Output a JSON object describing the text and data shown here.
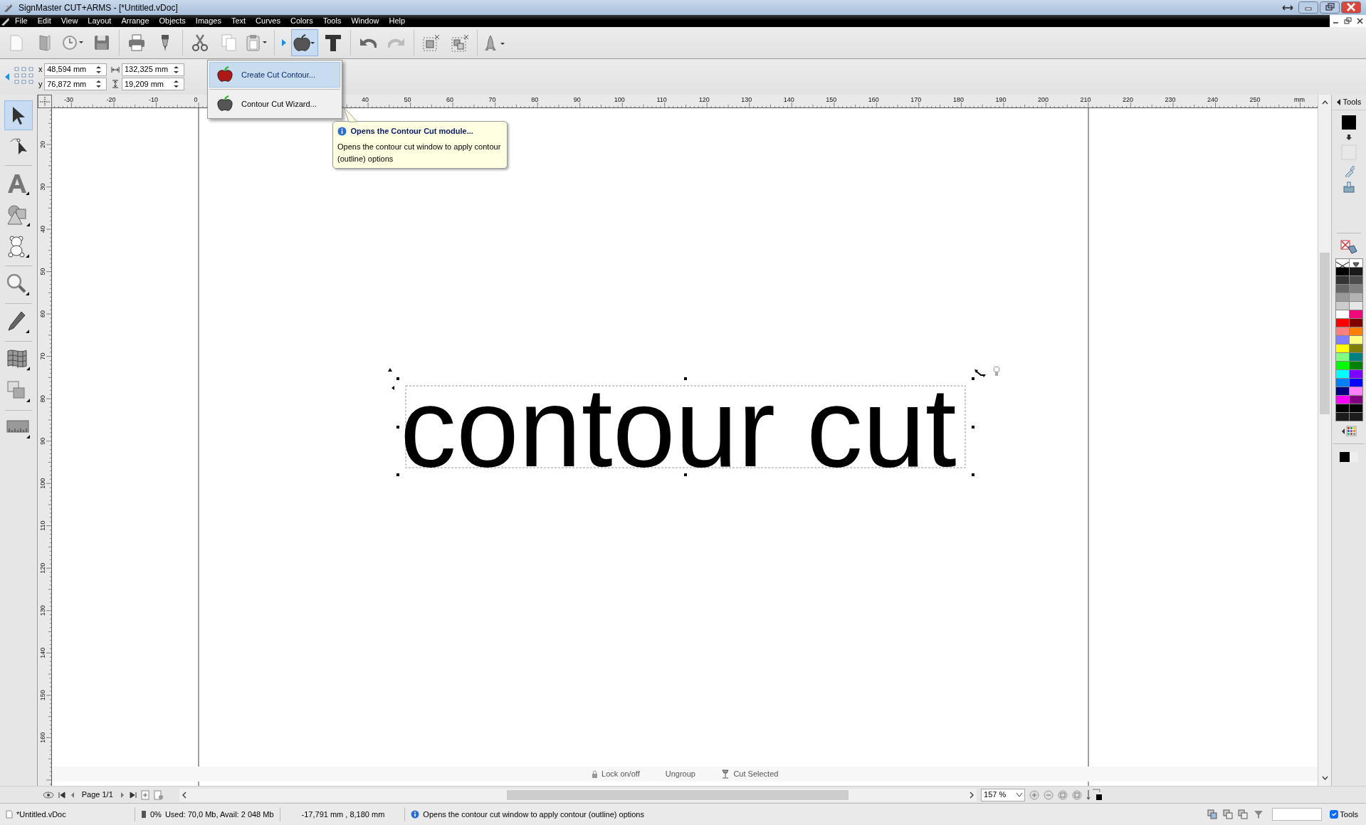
{
  "window": {
    "title": "SignMaster CUT+ARMS - [*Untitled.vDoc]"
  },
  "menu": [
    "File",
    "Edit",
    "View",
    "Layout",
    "Arrange",
    "Objects",
    "Images",
    "Text",
    "Curves",
    "Colors",
    "Tools",
    "Window",
    "Help"
  ],
  "toolbar": [
    {
      "kind": "new",
      "active": false
    },
    {
      "kind": "open",
      "active": false
    },
    {
      "kind": "history",
      "active": false
    },
    {
      "kind": "save",
      "active": false
    },
    {
      "kind": "sep"
    },
    {
      "kind": "print",
      "active": false
    },
    {
      "kind": "cutter",
      "active": false
    },
    {
      "kind": "sep"
    },
    {
      "kind": "cut",
      "active": false
    },
    {
      "kind": "copy",
      "active": false
    },
    {
      "kind": "paste",
      "active": false
    },
    {
      "kind": "sep"
    },
    {
      "kind": "expander",
      "active": false
    },
    {
      "kind": "contour",
      "active": true
    },
    {
      "kind": "text",
      "active": false
    },
    {
      "kind": "sep"
    },
    {
      "kind": "undo",
      "active": false
    },
    {
      "kind": "redo",
      "active": false
    },
    {
      "kind": "sep"
    },
    {
      "kind": "group",
      "active": false
    },
    {
      "kind": "ungroup",
      "active": false
    },
    {
      "kind": "sep"
    },
    {
      "kind": "shuttle",
      "active": false
    }
  ],
  "properties": {
    "x_label": "x",
    "x": "48,594 mm",
    "y_label": "y",
    "y": "76,872 mm",
    "width": "132,325 mm",
    "height": "19,209 mm"
  },
  "dropdown": [
    {
      "label": "Create Cut Contour...",
      "selected": true
    },
    {
      "label": "Contour Cut Wizard...",
      "selected": false
    }
  ],
  "tooltip": {
    "title": "Opens the Contour Cut module...",
    "text": "Opens the contour cut window to apply contour (outline) options"
  },
  "tools": [
    {
      "kind": "select",
      "selected": true
    },
    {
      "kind": "node",
      "selected": false
    },
    {
      "kind": "sep"
    },
    {
      "kind": "text",
      "selected": false
    },
    {
      "kind": "shapes",
      "selected": false
    },
    {
      "kind": "clipart",
      "selected": false
    },
    {
      "kind": "sep"
    },
    {
      "kind": "zoom",
      "selected": false
    },
    {
      "kind": "sep"
    },
    {
      "kind": "pencil",
      "selected": false
    },
    {
      "kind": "sep"
    },
    {
      "kind": "texture",
      "selected": false
    },
    {
      "kind": "weld",
      "selected": false
    },
    {
      "kind": "sep"
    },
    {
      "kind": "measure",
      "selected": false
    }
  ],
  "rulers": {
    "horizontal": [
      "-30",
      "-20",
      "-10",
      "0",
      "40",
      "50",
      "60",
      "70",
      "80",
      "90",
      "100",
      "110",
      "120",
      "130",
      "140",
      "150",
      "160",
      "170",
      "180",
      "190",
      "200",
      "210",
      "220",
      "230",
      "240",
      "250"
    ],
    "unit": "mm",
    "vertical": [
      "20",
      "30",
      "40",
      "50",
      "60",
      "70",
      "80",
      "90",
      "100",
      "110",
      "120",
      "130",
      "140",
      "150",
      "160"
    ]
  },
  "canvas": {
    "text": "contour cut"
  },
  "canvas_actions": [
    {
      "kind": "lock",
      "label": "Lock on/off"
    },
    {
      "kind": "plain",
      "label": "Ungroup"
    },
    {
      "kind": "cut",
      "label": "Cut Selected"
    }
  ],
  "page_nav": {
    "page": "Page 1/1",
    "zoom": "157 %"
  },
  "side_panel": {
    "title": "Tools",
    "palette": [
      {
        "color": "#000000"
      },
      {
        "color": "#1a1a1a"
      },
      {
        "color": "#333333"
      },
      {
        "color": "#4d4d4d"
      },
      {
        "color": "#666666"
      },
      {
        "color": "#808080"
      },
      {
        "color": "#999999"
      },
      {
        "color": "#b3b3b3"
      },
      {
        "color": "#cccccc"
      },
      {
        "color": "#e6e6e6"
      },
      {
        "color": "#ffffff"
      },
      {
        "color": "#f0087a"
      },
      {
        "color": "#ff0000"
      },
      {
        "color": "#800000"
      },
      {
        "color": "#ff8080"
      },
      {
        "color": "#ff8000"
      },
      {
        "color": "#8080ff"
      },
      {
        "color": "#ffff80"
      },
      {
        "color": "#ffff00"
      },
      {
        "color": "#808000"
      },
      {
        "color": "#80ff80"
      },
      {
        "color": "#008080"
      },
      {
        "color": "#00ff00"
      },
      {
        "color": "#008000"
      },
      {
        "color": "#00ffff"
      },
      {
        "color": "#8000ff"
      },
      {
        "color": "#0080ff"
      },
      {
        "color": "#0000ff"
      },
      {
        "color": "#000080"
      },
      {
        "color": "#ff80ff"
      },
      {
        "color": "#ff00ff"
      },
      {
        "color": "#800080"
      },
      {
        "color": "#020202"
      },
      {
        "color": "#050505"
      },
      {
        "color": "#1b1b1b"
      },
      {
        "color": "#1c1c1c"
      }
    ]
  },
  "status_bar": {
    "file": "*Untitled.vDoc",
    "memory_percent": "0%",
    "memory": "Used: 70,0 Mb, Avail: 2 048 Mb",
    "coords": "-17,791 mm , 8,180 mm",
    "hint": "Opens the contour cut window to apply contour (outline) options",
    "tools_label": "Tools",
    "tools_checked": true
  }
}
